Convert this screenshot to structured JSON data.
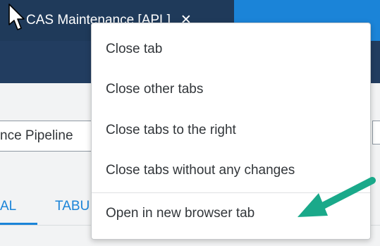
{
  "tab": {
    "title": "CAS Maintenance [APL]",
    "close_glyph": "✕"
  },
  "filter": {
    "pipeline_value": "nce Pipeline"
  },
  "page_tabs": [
    {
      "label": "AL"
    },
    {
      "label": "TABU"
    }
  ],
  "context_menu": {
    "items": [
      {
        "label": "Close tab"
      },
      {
        "label": "Close other tabs"
      },
      {
        "label": "Close tabs to the right"
      },
      {
        "label": "Close tabs without any changes"
      },
      {
        "label": "Open in new browser tab"
      }
    ]
  },
  "annotation": {
    "arrow_color": "#1aa98a",
    "icon": "arrow-icon"
  },
  "colors": {
    "tabbar": "#1b84d8",
    "active_tab": "#1f3a5a",
    "navbar": "#223d60",
    "accent": "#1b84d8"
  }
}
